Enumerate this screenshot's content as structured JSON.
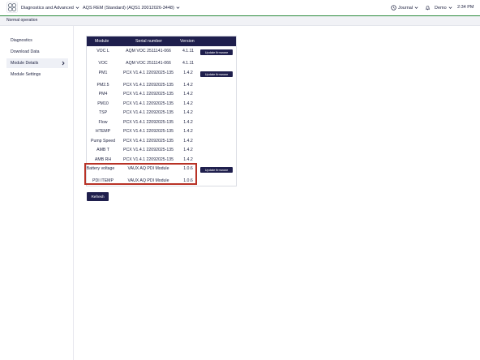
{
  "app": {
    "section_title": "Diagnostics and Advanced",
    "device_title": "AQS REM (Standard) (AQS1 20012026-3448)"
  },
  "header_right": {
    "journal_label": "Journal",
    "user_label": "Demo",
    "time": "2:34 PM"
  },
  "status": {
    "text": "Normal operation",
    "accent_color": "#2a8a3d"
  },
  "sidebar": {
    "items": [
      {
        "label": "Diagnostics"
      },
      {
        "label": "Download Data"
      },
      {
        "label": "Module Details"
      },
      {
        "label": "Module Settings"
      }
    ]
  },
  "table": {
    "headers": {
      "module": "Module",
      "serial": "Serial number",
      "version": "Version"
    },
    "rows": [
      {
        "module": "VOC L",
        "serial": "AQM VOC 2511141-066",
        "version": "4.1.11",
        "update": "Update firmware"
      },
      {
        "module": "VOC",
        "serial": "AQM VOC 2511141-066",
        "version": "4.1.11"
      },
      {
        "module": "PM1",
        "serial": "PCX V1.4.1 22092025-135",
        "version": "1.4.2",
        "update": "Update firmware"
      },
      {
        "module": "PM2.5",
        "serial": "PCX V1.4.1 22092025-135",
        "version": "1.4.2"
      },
      {
        "module": "PM4",
        "serial": "PCX V1.4.1 22092025-135",
        "version": "1.4.2"
      },
      {
        "module": "PM10",
        "serial": "PCX V1.4.1 22092025-135",
        "version": "1.4.2"
      },
      {
        "module": "TSP",
        "serial": "PCX V1.4.1 22092025-135",
        "version": "1.4.2"
      },
      {
        "module": "Flow",
        "serial": "PCX V1.4.1 22092025-135",
        "version": "1.4.2"
      },
      {
        "module": "HTEMP",
        "serial": "PCX V1.4.1 22092025-135",
        "version": "1.4.2"
      },
      {
        "module": "Pump Speed",
        "serial": "PCX V1.4.1 22092025-135",
        "version": "1.4.2"
      },
      {
        "module": "AMB T",
        "serial": "PCX V1.4.1 22092025-135",
        "version": "1.4.2"
      },
      {
        "module": "AMB RH",
        "serial": "PCX V1.4.1 22092025-135",
        "version": "1.4.2"
      },
      {
        "module": "Battery voltage",
        "serial": "VAUX AQ PDI Module",
        "version": "1.0.6",
        "update": "Update firmware"
      },
      {
        "module": "PDI ITEMP",
        "serial": "VAUX AQ PDI Module",
        "version": "1.0.6"
      }
    ]
  },
  "actions": {
    "refresh_label": "Refresh"
  },
  "colors": {
    "primary": "#1f1f4d",
    "highlight": "#b83226"
  },
  "icons": {
    "logo": "app-logo-icon",
    "journal": "clock-icon",
    "notifications": "bell-icon",
    "dropdown": "chevron-down-icon",
    "sidebar_active": "chevron-right-icon"
  }
}
